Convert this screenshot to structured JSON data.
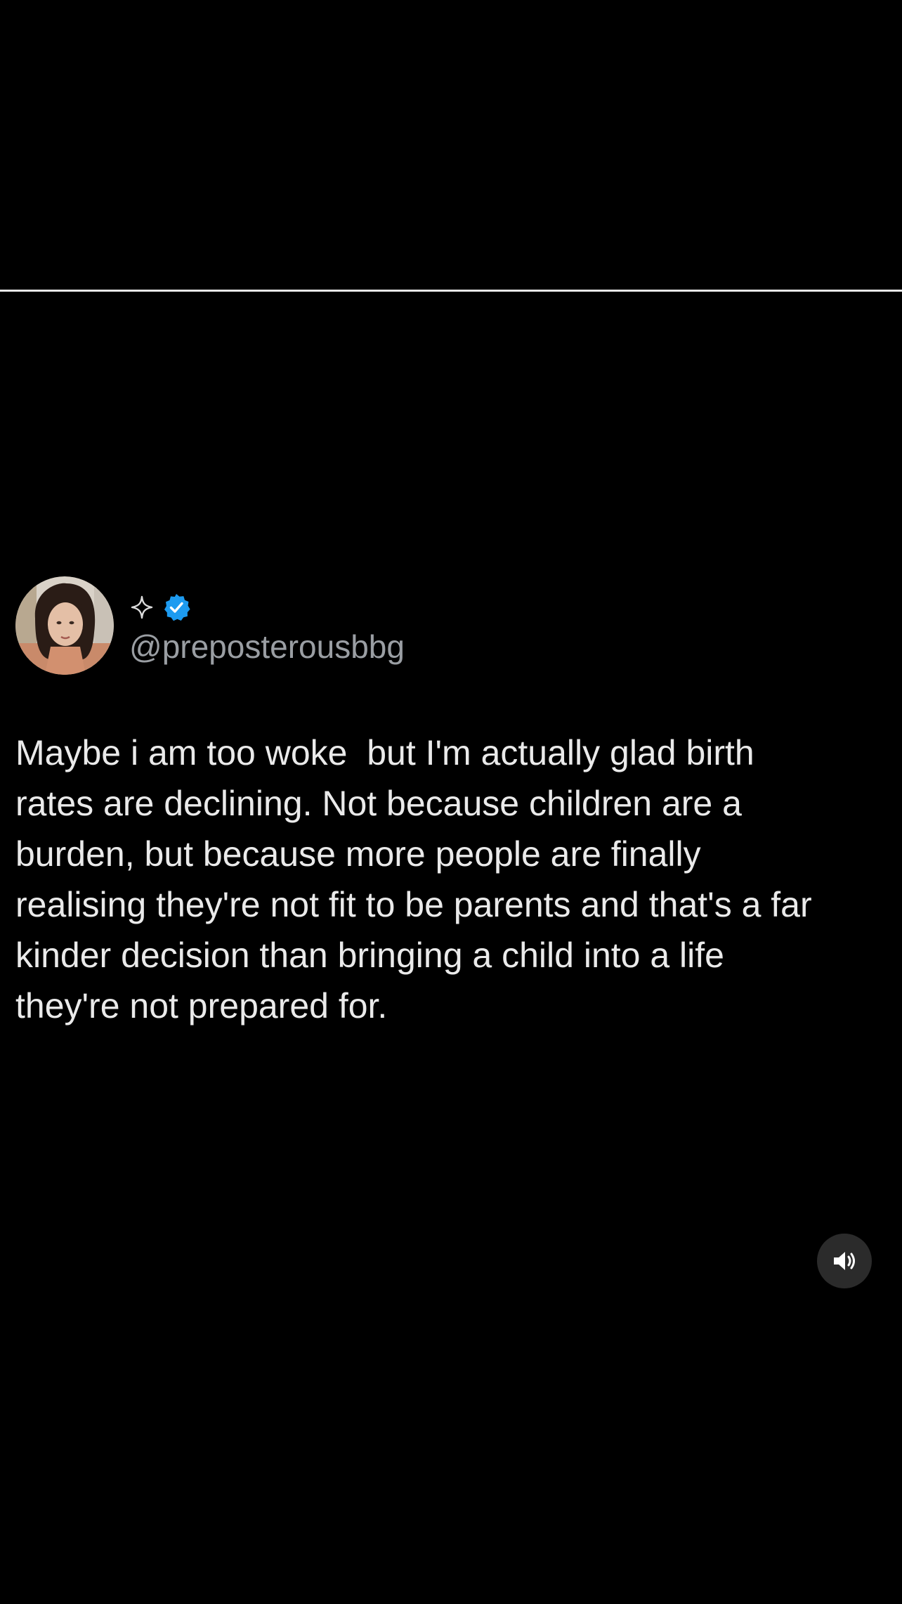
{
  "post": {
    "handle": "@preposterousbbg",
    "display_name_icon": "sparkle-icon",
    "verified_icon": "verified-badge-icon",
    "text": "Maybe i am too woke  but I'm actually glad birth\nrates are declining. Not because children are a\nburden, but because more people are finally\nrealising they're not fit to be parents and that's a far\nkinder decision than bringing a child into a life\nthey're not prepared for."
  },
  "player": {
    "sound_icon": "speaker-on-icon"
  },
  "colors": {
    "background": "#000000",
    "divider": "#e8e8e8",
    "text": "#eaeaea",
    "handle": "#9a9ea3",
    "verified": "#1d9bf0",
    "sound_button_bg": "#2b2b2b"
  }
}
